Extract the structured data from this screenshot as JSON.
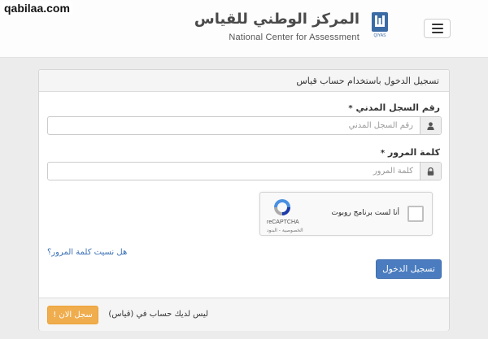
{
  "watermark": "qabilaa.com",
  "header": {
    "brand_ar": "المركز الوطني للقياس",
    "brand_en": "National Center for Assessment",
    "logo_caption": "QIYAS"
  },
  "panel": {
    "title": "تسجيل الدخول باستخدام حساب قياس",
    "national_id": {
      "label": "رقم السجل المدني",
      "required_mark": "*",
      "placeholder": "رقم السجل المدني",
      "value": ""
    },
    "password": {
      "label": "كلمة المرور",
      "required_mark": "*",
      "placeholder": "كلمة المرور",
      "value": ""
    },
    "captcha": {
      "label": "أنا لست برنامج روبوت",
      "brand": "reCAPTCHA",
      "terms": "الخصوصية - البنود",
      "checked": false
    },
    "forgot_password": "هل نسيت كلمة المرور؟",
    "login_button": "تسجيل الدخول",
    "footer": {
      "no_account": "ليس لديك حساب في (قياس)",
      "register_button": "سجل الان !"
    }
  },
  "colors": {
    "primary": "#4a7cbf",
    "warning": "#f0ad4e",
    "link": "#3a70b5",
    "logo": "#3b6ba5"
  },
  "icons": {
    "menu": "hamburger-icon",
    "national_id": "user-icon",
    "password": "lock-icon",
    "captcha": "recaptcha-icon"
  }
}
